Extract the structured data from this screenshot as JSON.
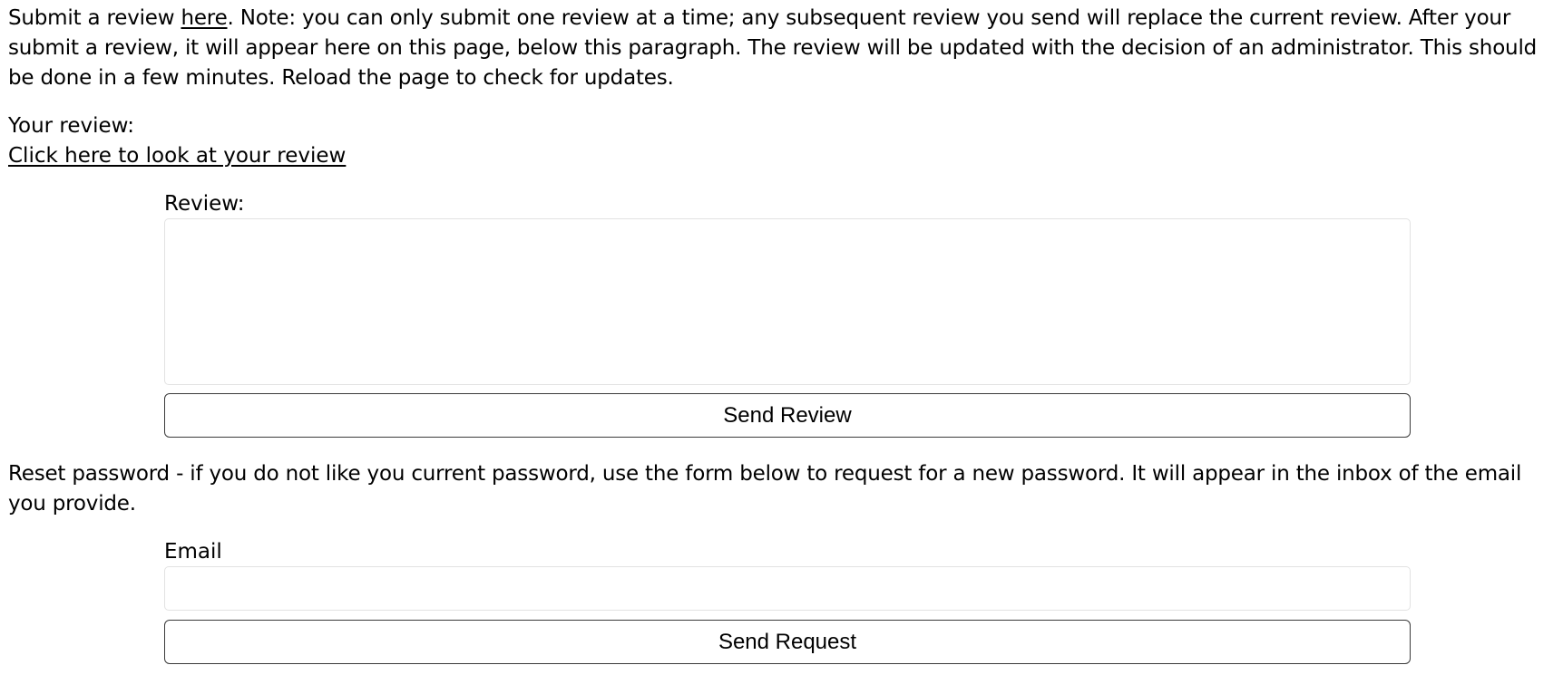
{
  "intro": {
    "prefix": "Submit a review ",
    "link_text": "here",
    "suffix": ". Note: you can only submit one review at a time; any subsequent review you send will replace the current review. After your submit a review, it will appear here on this page, below this paragraph. The review will be updated with the decision of an administrator. This should be done in a few minutes. Reload the page to check for updates."
  },
  "your_review": {
    "label": "Your review:",
    "link_text": "Click here to look at your review"
  },
  "review_form": {
    "label": "Review:",
    "value": "",
    "submit_label": "Send Review"
  },
  "reset": {
    "text": "Reset password - if you do not like you current password, use the form below to request for a new password. It will appear in the inbox of the email you provide."
  },
  "email_form": {
    "label": "Email",
    "value": "",
    "submit_label": "Send Request"
  }
}
